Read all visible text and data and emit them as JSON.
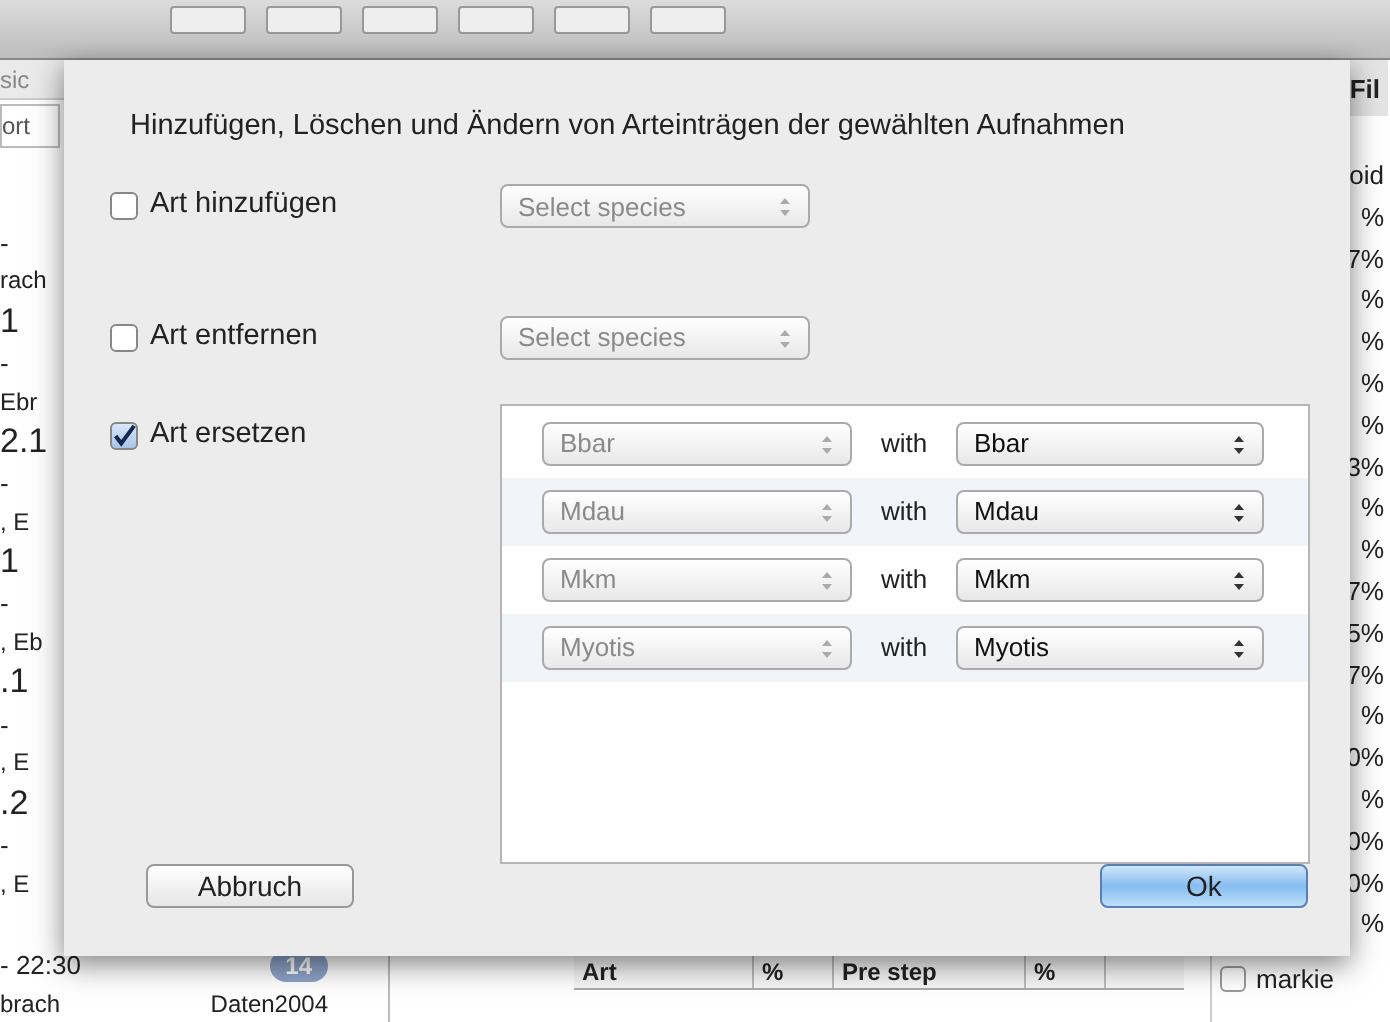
{
  "sidebar": {
    "header": "sic",
    "sort_field": "ort",
    "rows": [
      {
        "title": "",
        "time": "-",
        "place": "rach",
        "badge": ""
      },
      {
        "title": "1",
        "time": "-",
        "place": "Ebr",
        "badge": ""
      },
      {
        "title": "2.1",
        "time": "-",
        "place": ", E",
        "badge": ""
      },
      {
        "title": "1",
        "time": "-",
        "place": ", Eb",
        "badge": ""
      },
      {
        "title": ".1",
        "time": "-",
        "place": ", E",
        "badge": ""
      },
      {
        "title": ".2",
        "time": "-",
        "place": ", E",
        "badge": ""
      },
      {
        "title": "",
        "time": "- 22:30",
        "place": "brach",
        "source": "Daten2004",
        "badge": "14"
      }
    ]
  },
  "right_column": {
    "header": "Fil",
    "cells": [
      "oid",
      "%",
      "7%",
      "%",
      "%",
      "%",
      "%",
      "3%",
      "%",
      "%",
      "7%",
      "5%",
      "7%",
      "%",
      "0%",
      "%",
      "0%",
      "0%",
      "%"
    ]
  },
  "detail_table": {
    "columns": [
      "Art",
      "%",
      "Pre step",
      "%"
    ]
  },
  "right_panel": {
    "checkboxes": [
      {
        "label": "markie",
        "checked": false
      }
    ]
  },
  "sheet": {
    "title": "Hinzufügen, Löschen und Ändern von Arteinträgen der gewählten Aufnahmen",
    "options": [
      {
        "kind": "popup",
        "label": "Art hinzufügen",
        "checked": false,
        "value": "Select species"
      },
      {
        "kind": "popup",
        "label": "Art entfernen",
        "checked": false,
        "value": "Select species"
      },
      {
        "kind": "replace",
        "label": "Art ersetzen",
        "checked": true,
        "replacements": [
          {
            "from": "Bbar",
            "from_disabled": true,
            "joiner": "with",
            "to": "Bbar"
          },
          {
            "from": "Mdau",
            "from_disabled": true,
            "joiner": "with",
            "to": "Mdau"
          },
          {
            "from": "Mkm",
            "from_disabled": true,
            "joiner": "with",
            "to": "Mkm"
          },
          {
            "from": "Myotis",
            "from_disabled": true,
            "joiner": "with",
            "to": "Myotis"
          }
        ]
      }
    ],
    "cancel": "Abbruch",
    "ok": "Ok"
  }
}
